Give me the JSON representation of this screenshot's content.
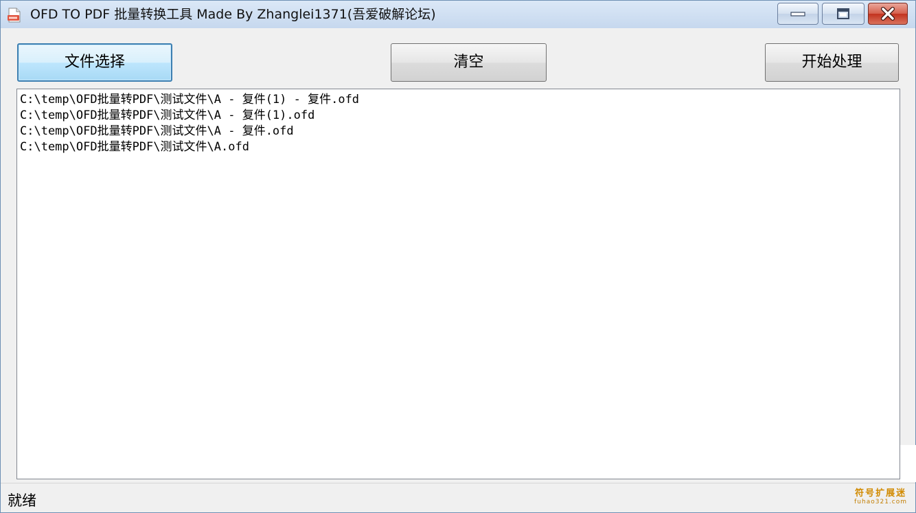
{
  "window": {
    "title": "OFD TO PDF 批量转换工具  Made By Zhanglei1371(吾爱破解论坛)",
    "icon": "pdf-file-icon"
  },
  "toolbar": {
    "select_label": "文件选择",
    "clear_label": "清空",
    "start_label": "开始处理"
  },
  "files": [
    "C:\\temp\\OFD批量转PDF\\测试文件\\A - 复件(1) - 复件.ofd",
    "C:\\temp\\OFD批量转PDF\\测试文件\\A - 复件(1).ofd",
    "C:\\temp\\OFD批量转PDF\\测试文件\\A - 复件.ofd",
    "C:\\temp\\OFD批量转PDF\\测试文件\\A.ofd"
  ],
  "status": {
    "text": "就绪"
  },
  "watermark": {
    "main": "符号扩展迷",
    "sub": "fuhao321.com"
  },
  "colors": {
    "selected_button_border": "#3c7fb1",
    "close_button": "#c2321e",
    "titlebar": "#c6d8ee"
  }
}
